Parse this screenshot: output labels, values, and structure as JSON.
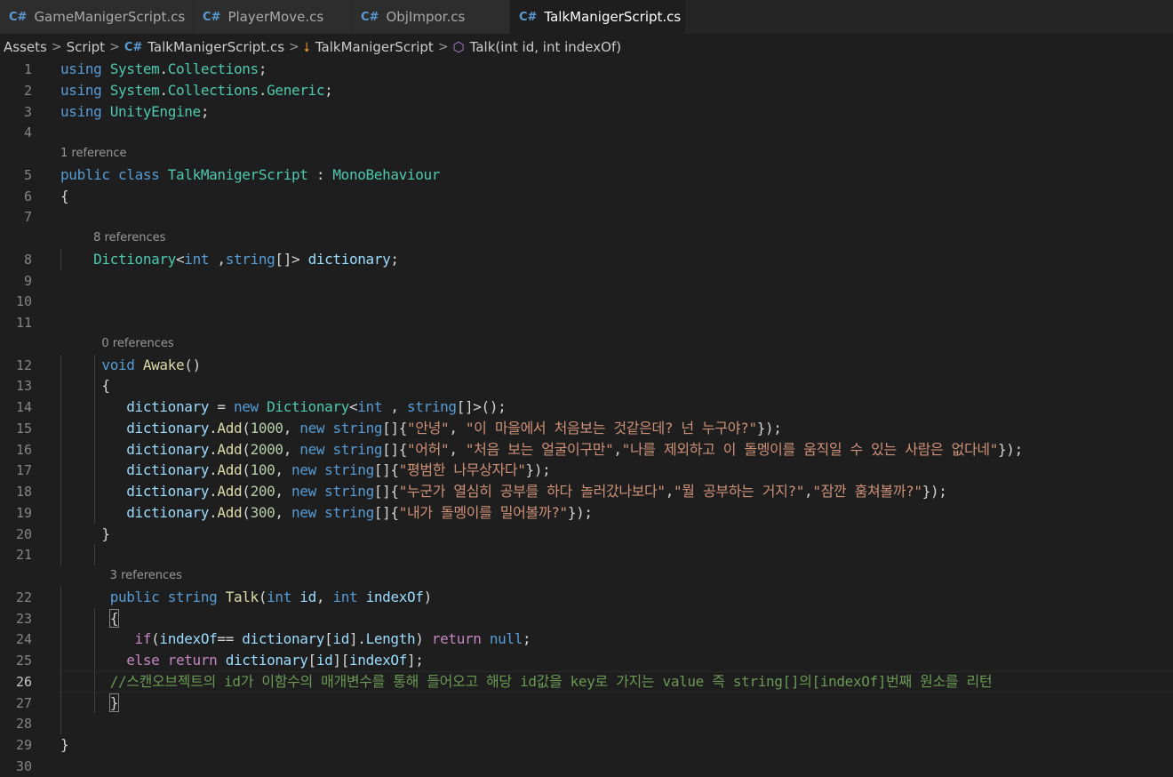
{
  "tabs": [
    {
      "icon": "C#",
      "label": "GameManigerScript.cs"
    },
    {
      "icon": "C#",
      "label": "PlayerMove.cs"
    },
    {
      "icon": "C#",
      "label": "ObjImpor.cs"
    },
    {
      "icon": "C#",
      "label": "TalkManigerScript.cs",
      "active": true,
      "unsaved": true
    }
  ],
  "breadcrumb": {
    "items": [
      "Assets",
      "Script",
      "TalkManigerScript.cs",
      "TalkManigerScript",
      "Talk(int id, int indexOf)"
    ],
    "separator": ">",
    "icons": [
      "csharp-file-icon",
      "class-icon",
      "method-icon"
    ]
  },
  "editor": {
    "current_line": 26,
    "codelens": [
      {
        "before_line": 5,
        "text": "1 reference"
      },
      {
        "before_line": 8,
        "text": "8 references"
      },
      {
        "before_line": 12,
        "text": "0 references"
      },
      {
        "before_line": 22,
        "text": "3 references"
      }
    ],
    "lines": [
      [
        [
          "kw",
          "using"
        ],
        [
          "pl",
          " "
        ],
        [
          "ty",
          "System"
        ],
        [
          "pl",
          "."
        ],
        [
          "ty",
          "Collections"
        ],
        [
          "pl",
          ";"
        ]
      ],
      [
        [
          "kw",
          "using"
        ],
        [
          "pl",
          " "
        ],
        [
          "ty",
          "System"
        ],
        [
          "pl",
          "."
        ],
        [
          "ty",
          "Collections"
        ],
        [
          "pl",
          "."
        ],
        [
          "ty",
          "Generic"
        ],
        [
          "pl",
          ";"
        ]
      ],
      [
        [
          "kw",
          "using"
        ],
        [
          "pl",
          " "
        ],
        [
          "ty",
          "UnityEngine"
        ],
        [
          "pl",
          ";"
        ]
      ],
      [],
      [
        [
          "kw",
          "public"
        ],
        [
          "pl",
          " "
        ],
        [
          "kw",
          "class"
        ],
        [
          "pl",
          " "
        ],
        [
          "ty",
          "TalkManigerScript"
        ],
        [
          "pl",
          " : "
        ],
        [
          "ty",
          "MonoBehaviour"
        ]
      ],
      [
        [
          "pl",
          "{"
        ]
      ],
      [],
      [
        [
          "pl",
          "    "
        ],
        [
          "ty",
          "Dictionary"
        ],
        [
          "pl",
          "<"
        ],
        [
          "kw",
          "int"
        ],
        [
          "pl",
          " ,"
        ],
        [
          "kw",
          "string"
        ],
        [
          "pl",
          "[]> "
        ],
        [
          "vr",
          "dictionary"
        ],
        [
          "pl",
          ";"
        ]
      ],
      [],
      [],
      [],
      [
        [
          "pl",
          "     "
        ],
        [
          "kw",
          "void"
        ],
        [
          "pl",
          " "
        ],
        [
          "fn",
          "Awake"
        ],
        [
          "pl",
          "()"
        ]
      ],
      [
        [
          "pl",
          "     {"
        ]
      ],
      [
        [
          "pl",
          "        "
        ],
        [
          "vr",
          "dictionary"
        ],
        [
          "pl",
          " = "
        ],
        [
          "kw",
          "new"
        ],
        [
          "pl",
          " "
        ],
        [
          "ty",
          "Dictionary"
        ],
        [
          "pl",
          "<"
        ],
        [
          "kw",
          "int"
        ],
        [
          "pl",
          " , "
        ],
        [
          "kw",
          "string"
        ],
        [
          "pl",
          "[]>();"
        ]
      ],
      [
        [
          "pl",
          "        "
        ],
        [
          "vr",
          "dictionary"
        ],
        [
          "pl",
          "."
        ],
        [
          "fn",
          "Add"
        ],
        [
          "pl",
          "("
        ],
        [
          "num",
          "1000"
        ],
        [
          "pl",
          ", "
        ],
        [
          "kw",
          "new"
        ],
        [
          "pl",
          " "
        ],
        [
          "kw",
          "string"
        ],
        [
          "pl",
          "[]{"
        ],
        [
          "str",
          "\"안녕\""
        ],
        [
          "pl",
          ", "
        ],
        [
          "str",
          "\"이 마을에서 처음보는 것같은데? 넌 누구야?\""
        ],
        [
          "pl",
          "});"
        ]
      ],
      [
        [
          "pl",
          "        "
        ],
        [
          "vr",
          "dictionary"
        ],
        [
          "pl",
          "."
        ],
        [
          "fn",
          "Add"
        ],
        [
          "pl",
          "("
        ],
        [
          "num",
          "2000"
        ],
        [
          "pl",
          ", "
        ],
        [
          "kw",
          "new"
        ],
        [
          "pl",
          " "
        ],
        [
          "kw",
          "string"
        ],
        [
          "pl",
          "[]{"
        ],
        [
          "str",
          "\"어허\""
        ],
        [
          "pl",
          ", "
        ],
        [
          "str",
          "\"처음 보는 얼굴이구만\""
        ],
        [
          "pl",
          ","
        ],
        [
          "str",
          "\"나를 제외하고 이 돌멩이를 움직일 수 있는 사람은 없다네\""
        ],
        [
          "pl",
          "});"
        ]
      ],
      [
        [
          "pl",
          "        "
        ],
        [
          "vr",
          "dictionary"
        ],
        [
          "pl",
          "."
        ],
        [
          "fn",
          "Add"
        ],
        [
          "pl",
          "("
        ],
        [
          "num",
          "100"
        ],
        [
          "pl",
          ", "
        ],
        [
          "kw",
          "new"
        ],
        [
          "pl",
          " "
        ],
        [
          "kw",
          "string"
        ],
        [
          "pl",
          "[]{"
        ],
        [
          "str",
          "\"평범한 나무상자다\""
        ],
        [
          "pl",
          "});"
        ]
      ],
      [
        [
          "pl",
          "        "
        ],
        [
          "vr",
          "dictionary"
        ],
        [
          "pl",
          "."
        ],
        [
          "fn",
          "Add"
        ],
        [
          "pl",
          "("
        ],
        [
          "num",
          "200"
        ],
        [
          "pl",
          ", "
        ],
        [
          "kw",
          "new"
        ],
        [
          "pl",
          " "
        ],
        [
          "kw",
          "string"
        ],
        [
          "pl",
          "[]{"
        ],
        [
          "str",
          "\"누군가 열심히 공부를 하다 놀러갔나보다\""
        ],
        [
          "pl",
          ","
        ],
        [
          "str",
          "\"뭘 공부하는 거지?\""
        ],
        [
          "pl",
          ","
        ],
        [
          "str",
          "\"잠깐 훔쳐볼까?\""
        ],
        [
          "pl",
          "});"
        ]
      ],
      [
        [
          "pl",
          "        "
        ],
        [
          "vr",
          "dictionary"
        ],
        [
          "pl",
          "."
        ],
        [
          "fn",
          "Add"
        ],
        [
          "pl",
          "("
        ],
        [
          "num",
          "300"
        ],
        [
          "pl",
          ", "
        ],
        [
          "kw",
          "new"
        ],
        [
          "pl",
          " "
        ],
        [
          "kw",
          "string"
        ],
        [
          "pl",
          "[]{"
        ],
        [
          "str",
          "\"내가 돌멩이를 밀어볼까?\""
        ],
        [
          "pl",
          "});"
        ]
      ],
      [
        [
          "pl",
          "     }"
        ]
      ],
      [],
      [
        [
          "pl",
          "      "
        ],
        [
          "kw",
          "public"
        ],
        [
          "pl",
          " "
        ],
        [
          "kw",
          "string"
        ],
        [
          "pl",
          " "
        ],
        [
          "fn",
          "Talk"
        ],
        [
          "pl",
          "("
        ],
        [
          "kw",
          "int"
        ],
        [
          "pl",
          " "
        ],
        [
          "vr",
          "id"
        ],
        [
          "pl",
          ", "
        ],
        [
          "kw",
          "int"
        ],
        [
          "pl",
          " "
        ],
        [
          "vr",
          "indexOf"
        ],
        [
          "pl",
          ")"
        ]
      ],
      [
        [
          "pl",
          "      "
        ],
        [
          "bb",
          "{"
        ]
      ],
      [
        [
          "pl",
          "         "
        ],
        [
          "ctl",
          "if"
        ],
        [
          "pl",
          "("
        ],
        [
          "vr",
          "indexOf"
        ],
        [
          "pl",
          "== "
        ],
        [
          "vr",
          "dictionary"
        ],
        [
          "pl",
          "["
        ],
        [
          "vr",
          "id"
        ],
        [
          "pl",
          "]."
        ],
        [
          "vr",
          "Length"
        ],
        [
          "pl",
          ") "
        ],
        [
          "ctl",
          "return"
        ],
        [
          "pl",
          " "
        ],
        [
          "kw",
          "null"
        ],
        [
          "pl",
          ";"
        ]
      ],
      [
        [
          "pl",
          "        "
        ],
        [
          "ctl",
          "else"
        ],
        [
          "pl",
          " "
        ],
        [
          "ctl",
          "return"
        ],
        [
          "pl",
          " "
        ],
        [
          "vr",
          "dictionary"
        ],
        [
          "pl",
          "["
        ],
        [
          "vr",
          "id"
        ],
        [
          "pl",
          "]["
        ],
        [
          "vr",
          "indexOf"
        ],
        [
          "pl",
          "];"
        ]
      ],
      [
        [
          "pl",
          "      "
        ],
        [
          "cm",
          "//스캔오브젝트의 id가 이함수의 매개변수를 통해 들어오고 해당 id값을 key로 가지는 value 즉 string[]의[indexOf]번째 원소를 리턴"
        ]
      ],
      [
        [
          "pl",
          "      "
        ],
        [
          "bb",
          "}"
        ]
      ],
      [],
      [
        [
          "pl",
          "}"
        ]
      ],
      []
    ]
  }
}
